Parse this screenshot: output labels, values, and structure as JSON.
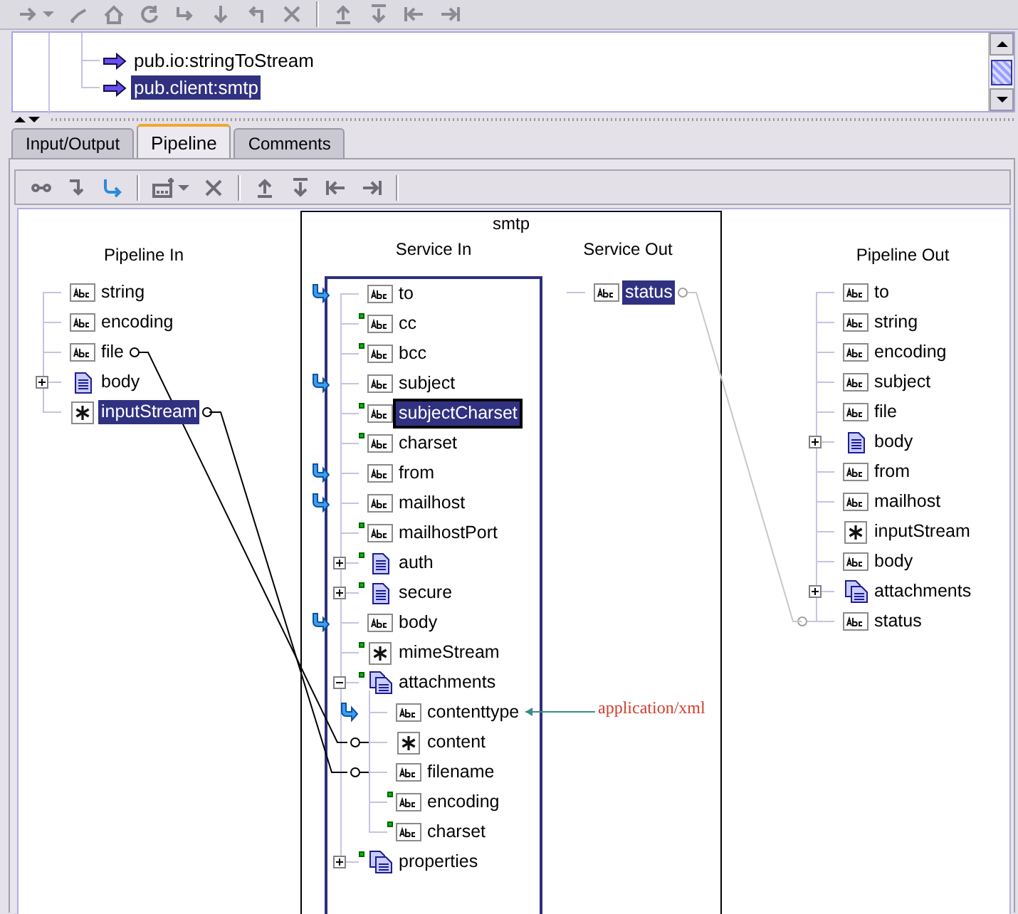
{
  "flow_tree": {
    "items": [
      {
        "label": "pub.io:stringToStream",
        "selected": false
      },
      {
        "label": "pub.client:smtp",
        "selected": true
      }
    ]
  },
  "tabs": [
    {
      "label": "Input/Output",
      "selected": false
    },
    {
      "label": "Pipeline",
      "selected": true
    },
    {
      "label": "Comments",
      "selected": false
    }
  ],
  "pipeline_in": {
    "title": "Pipeline In",
    "fields": [
      {
        "name": "string",
        "kind": "string",
        "selected": false,
        "linked": false
      },
      {
        "name": "encoding",
        "kind": "string",
        "selected": false,
        "linked": false
      },
      {
        "name": "file",
        "kind": "string",
        "selected": false,
        "linked": true
      },
      {
        "name": "body",
        "kind": "document",
        "selected": false,
        "linked": false,
        "expanded": false
      },
      {
        "name": "inputStream",
        "kind": "object",
        "selected": true,
        "linked": true
      }
    ]
  },
  "service": {
    "title": "smtp",
    "service_in": {
      "title": "Service In",
      "fields": [
        {
          "name": "to",
          "kind": "string",
          "selected": false,
          "linked": false,
          "optional": false,
          "mapped": true
        },
        {
          "name": "cc",
          "kind": "string",
          "selected": false,
          "linked": false,
          "optional": true,
          "mapped": false
        },
        {
          "name": "bcc",
          "kind": "string",
          "selected": false,
          "linked": false,
          "optional": true,
          "mapped": false
        },
        {
          "name": "subject",
          "kind": "string",
          "selected": false,
          "linked": false,
          "optional": false,
          "mapped": true
        },
        {
          "name": "subjectCharset",
          "kind": "string",
          "selected": true,
          "linked": false,
          "optional": true,
          "mapped": false
        },
        {
          "name": "charset",
          "kind": "string",
          "selected": false,
          "linked": false,
          "optional": true,
          "mapped": false
        },
        {
          "name": "from",
          "kind": "string",
          "selected": false,
          "linked": false,
          "optional": false,
          "mapped": true
        },
        {
          "name": "mailhost",
          "kind": "string",
          "selected": false,
          "linked": false,
          "optional": false,
          "mapped": true
        },
        {
          "name": "mailhostPort",
          "kind": "string",
          "selected": false,
          "linked": false,
          "optional": true,
          "mapped": false
        },
        {
          "name": "auth",
          "kind": "document",
          "selected": false,
          "linked": false,
          "optional": true,
          "mapped": false,
          "expanded": false
        },
        {
          "name": "secure",
          "kind": "document",
          "selected": false,
          "linked": false,
          "optional": true,
          "mapped": false,
          "expanded": false
        },
        {
          "name": "body",
          "kind": "string",
          "selected": false,
          "linked": false,
          "optional": false,
          "mapped": true
        },
        {
          "name": "mimeStream",
          "kind": "object",
          "selected": false,
          "linked": false,
          "optional": true,
          "mapped": false
        },
        {
          "name": "attachments",
          "kind": "doclist",
          "selected": false,
          "linked": false,
          "optional": true,
          "mapped": false,
          "expanded": true,
          "children": [
            {
              "name": "contenttype",
              "kind": "string",
              "selected": false,
              "linked": false,
              "optional": false,
              "mapped": true
            },
            {
              "name": "content",
              "kind": "object",
              "selected": false,
              "linked": true,
              "optional": false,
              "mapped": false
            },
            {
              "name": "filename",
              "kind": "string",
              "selected": false,
              "linked": true,
              "optional": false,
              "mapped": false
            },
            {
              "name": "encoding",
              "kind": "string",
              "selected": false,
              "linked": false,
              "optional": true,
              "mapped": false
            },
            {
              "name": "charset",
              "kind": "string",
              "selected": false,
              "linked": false,
              "optional": true,
              "mapped": false
            }
          ]
        },
        {
          "name": "properties",
          "kind": "doclist",
          "selected": false,
          "linked": false,
          "optional": true,
          "mapped": false,
          "expanded": false
        }
      ]
    },
    "service_out": {
      "title": "Service Out",
      "fields": [
        {
          "name": "status",
          "kind": "string",
          "selected": true,
          "linked": true
        }
      ]
    }
  },
  "pipeline_out": {
    "title": "Pipeline Out",
    "fields": [
      {
        "name": "to",
        "kind": "string",
        "selected": false,
        "linked": false
      },
      {
        "name": "string",
        "kind": "string",
        "selected": false,
        "linked": false
      },
      {
        "name": "encoding",
        "kind": "string",
        "selected": false,
        "linked": false
      },
      {
        "name": "subject",
        "kind": "string",
        "selected": false,
        "linked": false
      },
      {
        "name": "file",
        "kind": "string",
        "selected": false,
        "linked": false
      },
      {
        "name": "body",
        "kind": "document",
        "selected": false,
        "linked": false,
        "expanded": false
      },
      {
        "name": "from",
        "kind": "string",
        "selected": false,
        "linked": false
      },
      {
        "name": "mailhost",
        "kind": "string",
        "selected": false,
        "linked": false
      },
      {
        "name": "inputStream",
        "kind": "object",
        "selected": false,
        "linked": false
      },
      {
        "name": "body",
        "kind": "string",
        "selected": false,
        "linked": false
      },
      {
        "name": "attachments",
        "kind": "doclist",
        "selected": false,
        "linked": false,
        "expanded": false
      },
      {
        "name": "status",
        "kind": "string",
        "selected": false,
        "linked": true
      }
    ]
  },
  "annotation": {
    "text": "application/xml"
  }
}
